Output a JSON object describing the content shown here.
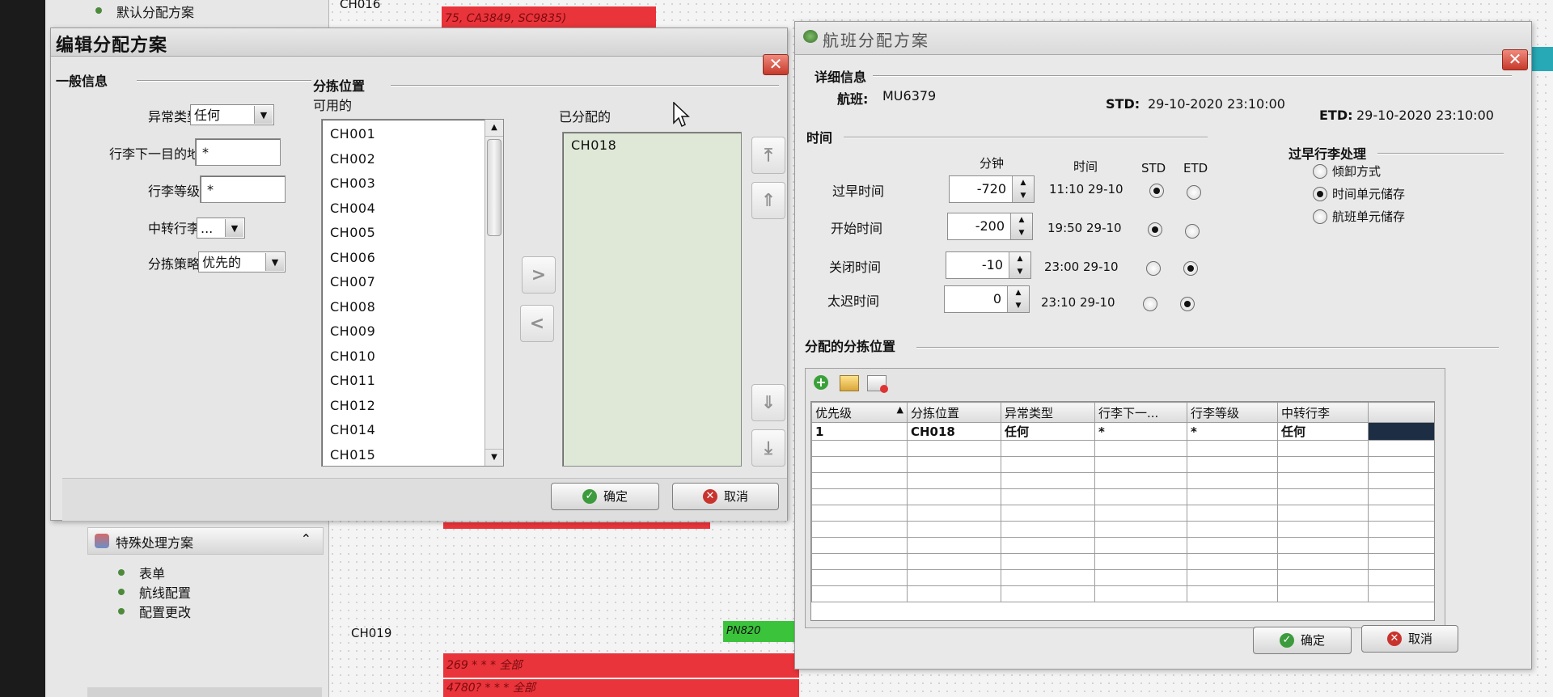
{
  "background": {
    "top_row_label": "CH016",
    "top_red_bar_text": "75, CA3849, SC9835)",
    "bottom_row_label": "CH019",
    "bottom_green_text": "PN820",
    "bottom_red_bar1_text": "269 * * * 全部",
    "bottom_red_bar2_text": "4780? * * * 全部"
  },
  "left_panel": {
    "top_item": "默认分配方案",
    "special_header": "特殊处理方案",
    "special_items": [
      "表单",
      "航线配置",
      "配置更改"
    ]
  },
  "edit_dialog": {
    "title": "编辑分配方案",
    "general_section": "一般信息",
    "fields": {
      "exception_type_label": "异常类型",
      "exception_type_value": "任何",
      "destination_label": "行李下一目的地",
      "destination_value": "*",
      "grade_label": "行李等级",
      "grade_value": "*",
      "transfer_label": "中转行李",
      "transfer_value": "...",
      "strategy_label": "分拣策略",
      "strategy_value": "优先的"
    },
    "sort_section": "分拣位置",
    "available_label": "可用的",
    "assigned_label": "已分配的",
    "available_items": [
      "CH001",
      "CH002",
      "CH003",
      "CH004",
      "CH005",
      "CH006",
      "CH007",
      "CH008",
      "CH009",
      "CH010",
      "CH011",
      "CH012",
      "CH014",
      "CH015"
    ],
    "assigned_items": [
      "CH018"
    ],
    "move_right": ">",
    "move_left": "<",
    "ok_label": "确定",
    "cancel_label": "取消"
  },
  "flight_dialog": {
    "title": "航班分配方案",
    "detail_section": "详细信息",
    "flight_label": "航班:",
    "flight_value": "MU6379",
    "std_label": "STD:",
    "std_value": "29-10-2020 23:10:00",
    "etd_label": "ETD:",
    "etd_value": "29-10-2020 23:10:00",
    "time_section": "时间",
    "col_minutes": "分钟",
    "col_time": "时间",
    "col_std": "STD",
    "col_etd": "ETD",
    "time_rows": [
      {
        "label": "过早时间",
        "minutes": "-720",
        "time": "11:10 29-10",
        "std": true,
        "etd": false
      },
      {
        "label": "开始时间",
        "minutes": "-200",
        "time": "19:50 29-10",
        "std": true,
        "etd": false
      },
      {
        "label": "关闭时间",
        "minutes": "-10",
        "time": "23:00 29-10",
        "std": false,
        "etd": true
      },
      {
        "label": "太迟时间",
        "minutes": "0",
        "time": "23:10 29-10",
        "std": false,
        "etd": true
      }
    ],
    "early_section": "过早行李处理",
    "early_options": [
      {
        "label": "倾卸方式",
        "selected": false
      },
      {
        "label": "时间单元储存",
        "selected": true
      },
      {
        "label": "航班单元储存",
        "selected": false
      }
    ],
    "assigned_section": "分配的分拣位置",
    "table_headers": [
      "优先级",
      "分拣位置",
      "异常类型",
      "行李下一...",
      "行李等级",
      "中转行李"
    ],
    "table_rows": [
      [
        "1",
        "CH018",
        "任何",
        "*",
        "*",
        "任何"
      ]
    ],
    "ok_label": "确定",
    "cancel_label": "取消"
  },
  "colors": {
    "red_bar": "#e8343a",
    "green_bar": "#3bc43b",
    "assigned_list_bg": "#dfe8d7",
    "cyan_strip": "#28a9b6"
  }
}
